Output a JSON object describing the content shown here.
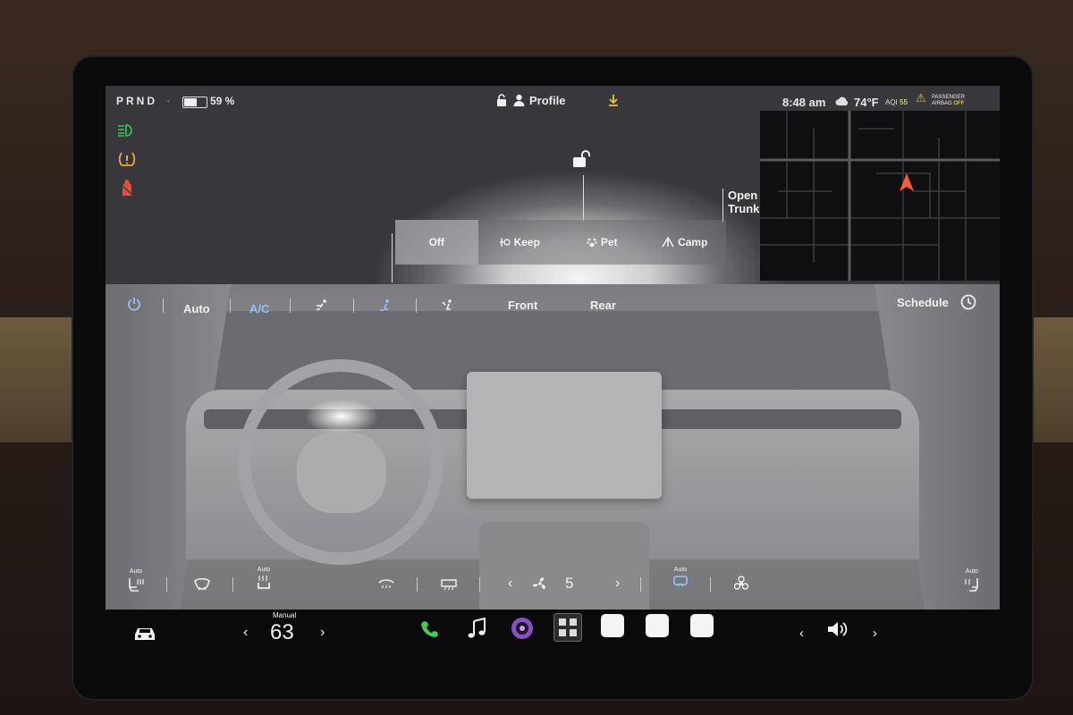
{
  "status": {
    "gear": "PRND",
    "battery_percent": 59,
    "battery_label": "59 %",
    "profile_label": "Profile",
    "time": "8:48 am",
    "temperature": "74°F",
    "aqi_label": "AQI",
    "aqi_value": "55",
    "passenger_airbag": "PASSENGER",
    "airbag_label": "AIRBAG",
    "airbag_state": "OFF"
  },
  "car": {
    "open_trunk_line1": "Open",
    "open_trunk_line2": "Trunk"
  },
  "modes": [
    {
      "label": "Off",
      "icon": "off",
      "active": true
    },
    {
      "label": "Keep",
      "icon": "keep-fan-icon",
      "active": false
    },
    {
      "label": "Pet",
      "icon": "paw-icon",
      "active": false
    },
    {
      "label": "Camp",
      "icon": "tent-icon",
      "active": false
    }
  ],
  "climate": {
    "auto_label": "Auto",
    "ac_label": "A/C",
    "front_label": "Front",
    "rear_label": "Rear",
    "schedule_label": "Schedule",
    "fan_speed": "5",
    "seat_auto": "Auto"
  },
  "taskbar": {
    "manual_label": "Manual",
    "cabin_temp": "63"
  },
  "colors": {
    "accent_blue": "#8fc4ff",
    "warning_yellow": "#e2c23a",
    "headlight_green": "#35c95a",
    "phone_green": "#3ccf5b",
    "seatbelt_red": "#e0523a"
  }
}
